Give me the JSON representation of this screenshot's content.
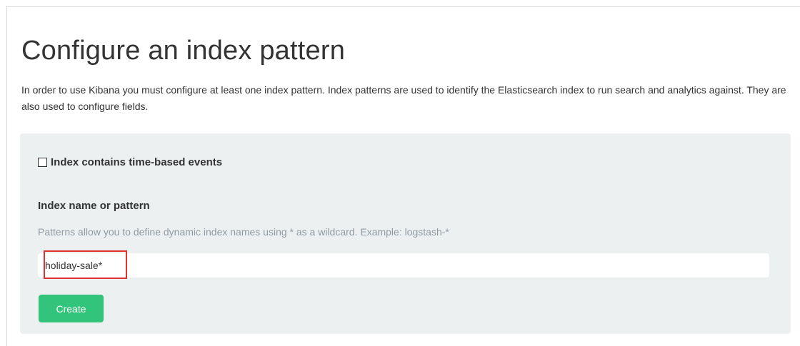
{
  "page": {
    "title": "Configure an index pattern",
    "intro": "In order to use Kibana you must configure at least one index pattern. Index patterns are used to identify the Elasticsearch index to run search and analytics against. They are also used to configure fields."
  },
  "form": {
    "time_based_checkbox_label": "Index contains time-based events",
    "time_based_checked": false,
    "index_name_label": "Index name or pattern",
    "help_text": "Patterns allow you to define dynamic index names using * as a wildcard. Example: logstash-*",
    "index_input_value": "holiday-sale*",
    "create_button_label": "Create"
  },
  "colors": {
    "panel_background": "#ecf0f1",
    "create_button": "#31c47a",
    "highlight_border": "#e03131",
    "help_text": "#8f9ba3"
  }
}
